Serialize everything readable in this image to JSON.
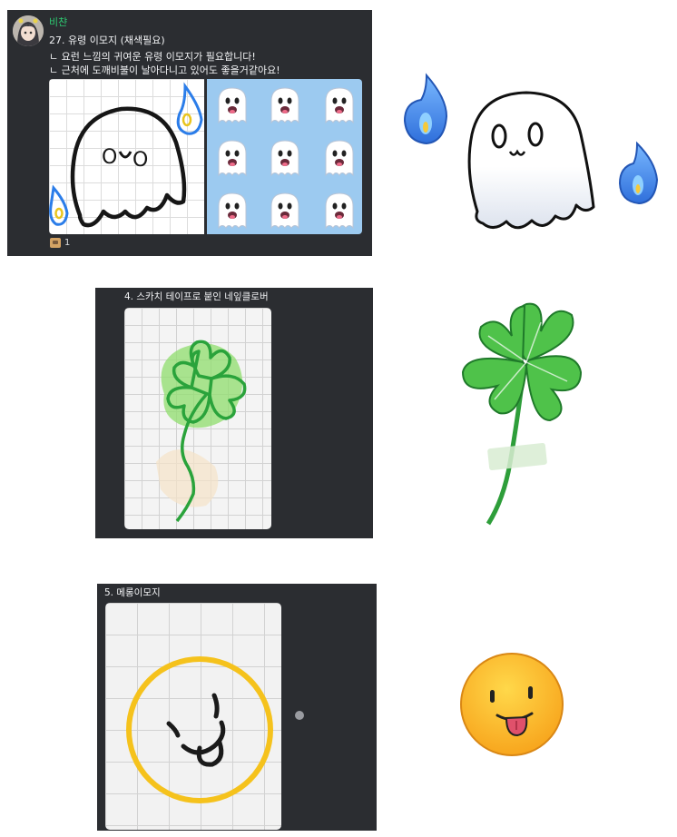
{
  "post1": {
    "username": "비챤",
    "lines": [
      "27. 유령 이모지 (채색필요)",
      "ㄴ 요런 느낌의 귀여운 유령 이모지가 필요합니다!",
      "ㄴ 근처에 도깨비불이 날아다니고 있어도 좋을거같아요!"
    ],
    "reaction_count": "1"
  },
  "post2": {
    "caption": "4. 스카치 테이프로 붙인 네잎클로버"
  },
  "post3": {
    "caption": "5. 메롱이모지"
  },
  "colors": {
    "panel": "#2b2d31",
    "username": "#2dc770",
    "ghost_flame": "#3a8df0",
    "clover_green": "#45b848",
    "smiley_yellow": "#f7c623",
    "tongue": "#e0516b"
  },
  "icons": [
    "avatar",
    "ghost-emoji",
    "blue-flame-icon",
    "four-leaf-clover",
    "smiley-tongue-emoji",
    "reaction-emoji"
  ]
}
